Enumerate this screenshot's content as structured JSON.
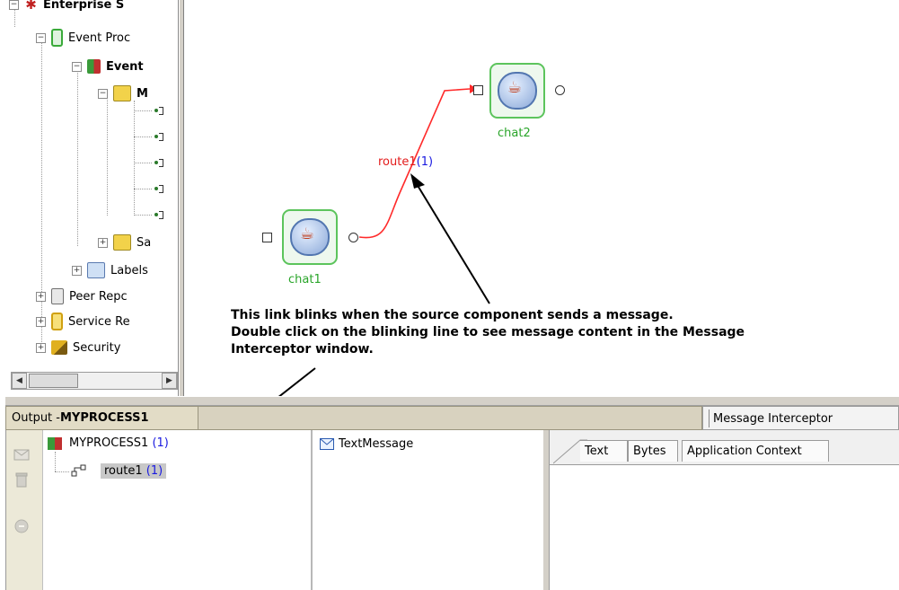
{
  "tree": {
    "root_label": "Enterprise S",
    "event_processing_label": "Event Proc",
    "event_label": "Event",
    "module_label": "M",
    "sub_label": "Sa",
    "labels_label": "Labels",
    "peer_label": "Peer Repc",
    "service_label": "Service Re",
    "security_label": "Security"
  },
  "canvas": {
    "components": {
      "chat1": "chat1",
      "chat2": "chat2"
    },
    "route": {
      "name": "route1",
      "count": "(1)"
    },
    "annotation": {
      "line1": "This link blinks when the source component sends a message.",
      "line2": "Double click on the blinking line to see message content in the Message",
      "line3": "Interceptor window."
    },
    "colors": {
      "route_line": "#ff2a2a",
      "component_border": "#5cc45c",
      "component_label": "#2aa52a",
      "count": "#1a1ae0"
    }
  },
  "output": {
    "tab_prefix": "Output - ",
    "tab_process": "MYPROCESS1",
    "tree": {
      "process_label": "MYPROCESS1",
      "process_count": "(1)",
      "route_label": "route1",
      "route_count": "(1)"
    }
  },
  "message_interceptor": {
    "tab_label": "Message Interceptor",
    "message_item": "TextMessage",
    "detail_tabs": [
      "Text",
      "Bytes",
      "Application Context"
    ]
  }
}
